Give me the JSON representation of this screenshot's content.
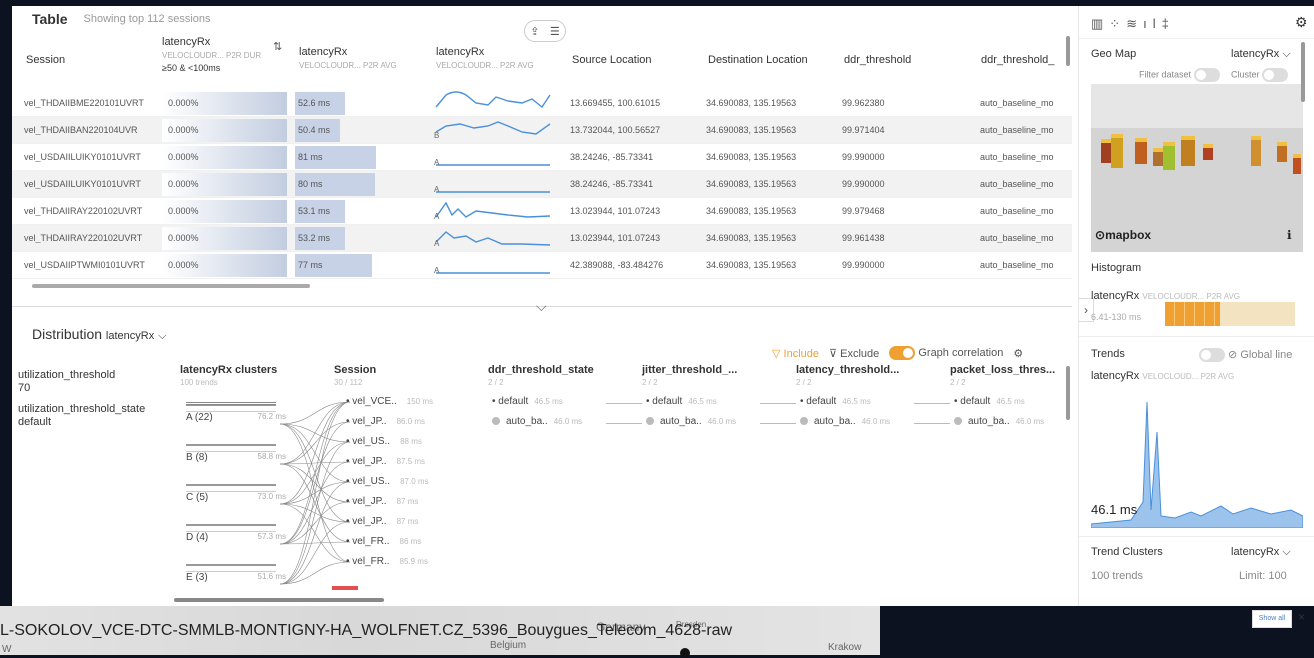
{
  "table": {
    "title": "Table",
    "subtitle": "Showing top 112 sessions",
    "columns": [
      {
        "name": "Session",
        "sub": ""
      },
      {
        "name": "latencyRx",
        "sub": "VELOCLOUDR... P2R DUR",
        "extra": "≥50 & <100ms"
      },
      {
        "name": "latencyRx",
        "sub": "VELOCLOUDR... P2R AVG"
      },
      {
        "name": "latencyRx",
        "sub": "VELOCLOUDR... P2R AVG"
      },
      {
        "name": "Source Location",
        "sub": ""
      },
      {
        "name": "Destination Location",
        "sub": ""
      },
      {
        "name": "ddr_threshold",
        "sub": ""
      },
      {
        "name": "ddr_threshold_",
        "sub": ""
      }
    ],
    "rows": [
      {
        "session": "vel_THDAIIBME220101UVRT",
        "dur": "0.000%",
        "avg": "52.6 ms",
        "avg_frac": 0.55,
        "spark_label": "",
        "src": "13.669455, 100.61015",
        "dst": "34.690083, 135.19563",
        "ddr": "99.962380",
        "ddr2": "auto_baseline_mo"
      },
      {
        "session": "vel_THDAIIBAN220104UVR",
        "dur": "0.000%",
        "avg": "50.4 ms",
        "avg_frac": 0.5,
        "spark_label": "B",
        "src": "13.732044, 100.56527",
        "dst": "34.690083, 135.19563",
        "ddr": "99.971404",
        "ddr2": "auto_baseline_mo"
      },
      {
        "session": "vel_USDAIILUIKY0101UVRT",
        "dur": "0.000%",
        "avg": "81 ms",
        "avg_frac": 0.9,
        "spark_label": "A",
        "src": "38.24246, -85.73341",
        "dst": "34.690083, 135.19563",
        "ddr": "99.990000",
        "ddr2": "auto_baseline_mo"
      },
      {
        "session": "vel_USDAIILUIKY0101UVRT",
        "dur": "0.000%",
        "avg": "80 ms",
        "avg_frac": 0.89,
        "spark_label": "A",
        "src": "38.24246, -85.73341",
        "dst": "34.690083, 135.19563",
        "ddr": "99.990000",
        "ddr2": "auto_baseline_mo"
      },
      {
        "session": "vel_THDAIIRAY220102UVRT",
        "dur": "0.000%",
        "avg": "53.1 ms",
        "avg_frac": 0.56,
        "spark_label": "A",
        "src": "13.023944, 101.07243",
        "dst": "34.690083, 135.19563",
        "ddr": "99.979468",
        "ddr2": "auto_baseline_mo"
      },
      {
        "session": "vel_THDAIIRAY220102UVRT",
        "dur": "0.000%",
        "avg": "53.2 ms",
        "avg_frac": 0.56,
        "spark_label": "A",
        "src": "13.023944, 101.07243",
        "dst": "34.690083, 135.19563",
        "ddr": "99.961438",
        "ddr2": "auto_baseline_mo"
      },
      {
        "session": "vel_USDAIIPTWMI0101UVRT",
        "dur": "0.000%",
        "avg": "77 ms",
        "avg_frac": 0.85,
        "spark_label": "A",
        "src": "42.389088, -83.484276",
        "dst": "34.690083, 135.19563",
        "ddr": "99.990000",
        "ddr2": "auto_baseline_mo"
      }
    ]
  },
  "distribution": {
    "title": "Distribution",
    "metric": "latencyRx",
    "include_label": "Include",
    "exclude_label": "Exclude",
    "graph_corr_label": "Graph correlation",
    "filters": [
      {
        "name": "utilization_threshold",
        "value": "70"
      },
      {
        "name": "utilization_threshold_state",
        "value": "default"
      }
    ],
    "clusters_header": {
      "title": "latencyRx clusters",
      "sub": "100 trends"
    },
    "clusters": [
      {
        "label": "A (22)",
        "value": "76.2 ms"
      },
      {
        "label": "B (8)",
        "value": "58.8 ms"
      },
      {
        "label": "C (5)",
        "value": "73.0 ms"
      },
      {
        "label": "D (4)",
        "value": "57.3 ms"
      },
      {
        "label": "E (3)",
        "value": "51.6 ms"
      }
    ],
    "session_header": {
      "title": "Session",
      "sub": "30 / 112"
    },
    "sessions": [
      {
        "label": "vel_VCE..",
        "value": "150 ms"
      },
      {
        "label": "vel_JP..",
        "value": "86.0 ms"
      },
      {
        "label": "vel_US..",
        "value": "88 ms"
      },
      {
        "label": "vel_JP..",
        "value": "87.5 ms"
      },
      {
        "label": "vel_US..",
        "value": "87.0 ms"
      },
      {
        "label": "vel_JP..",
        "value": "87 ms"
      },
      {
        "label": "vel_JP..",
        "value": "87 ms"
      },
      {
        "label": "vel_FR..",
        "value": "86 ms"
      },
      {
        "label": "vel_FR..",
        "value": "85.9 ms"
      }
    ],
    "state_cols": [
      {
        "title": "ddr_threshold_state",
        "sub": "2 / 2",
        "n1": "default",
        "v1": "46.5 ms",
        "n2": "auto_ba..",
        "v2": "46.0 ms"
      },
      {
        "title": "jitter_threshold_...",
        "sub": "2 / 2",
        "n1": "default",
        "v1": "46.5 ms",
        "n2": "auto_ba..",
        "v2": "46.0 ms"
      },
      {
        "title": "latency_threshold...",
        "sub": "2 / 2",
        "n1": "default",
        "v1": "46.5 ms",
        "n2": "auto_ba..",
        "v2": "46.0 ms"
      },
      {
        "title": "packet_loss_thres...",
        "sub": "2 / 2",
        "n1": "default",
        "v1": "46.5 ms",
        "n2": "auto_ba..",
        "v2": "46.0 ms"
      }
    ]
  },
  "right_panel": {
    "geo_title": "Geo Map",
    "geo_metric": "latencyRx",
    "filter_dataset": "Filter dataset",
    "cluster": "Cluster",
    "mapbox": "mapbox",
    "histogram_title": "Histogram",
    "hist_metric": "latencyRx",
    "hist_sub": "VELOCLOUDR... P2R AVG",
    "hist_range": "6.41-130 ms",
    "hist_fill": 0.42,
    "trends_title": "Trends",
    "global_line": "Global line",
    "trend_metric": "latencyRx",
    "trend_sub": "VELOCLOUD... P2R AVG",
    "trend_value": "46.1 ms",
    "trend_clusters_title": "Trend Clusters",
    "trend_clusters_metric": "latencyRx",
    "trend_count": "100 trends",
    "limit": "Limit: 100"
  },
  "bottom": {
    "title": "L-SOKOLOV_VCE-DTC-SMMLB-MONTIGNY-HA_WOLFNET.CZ_5396_Bouygues_Telecom_4628-raw",
    "map_labels": [
      "Germany",
      "Dresden",
      "Belgium",
      "Krakow",
      "W"
    ],
    "show_all": "Show all",
    "close": "×"
  },
  "colors": {
    "accent": "#f0a030",
    "bar": "#c7d2e6",
    "line": "#4a90d9"
  }
}
